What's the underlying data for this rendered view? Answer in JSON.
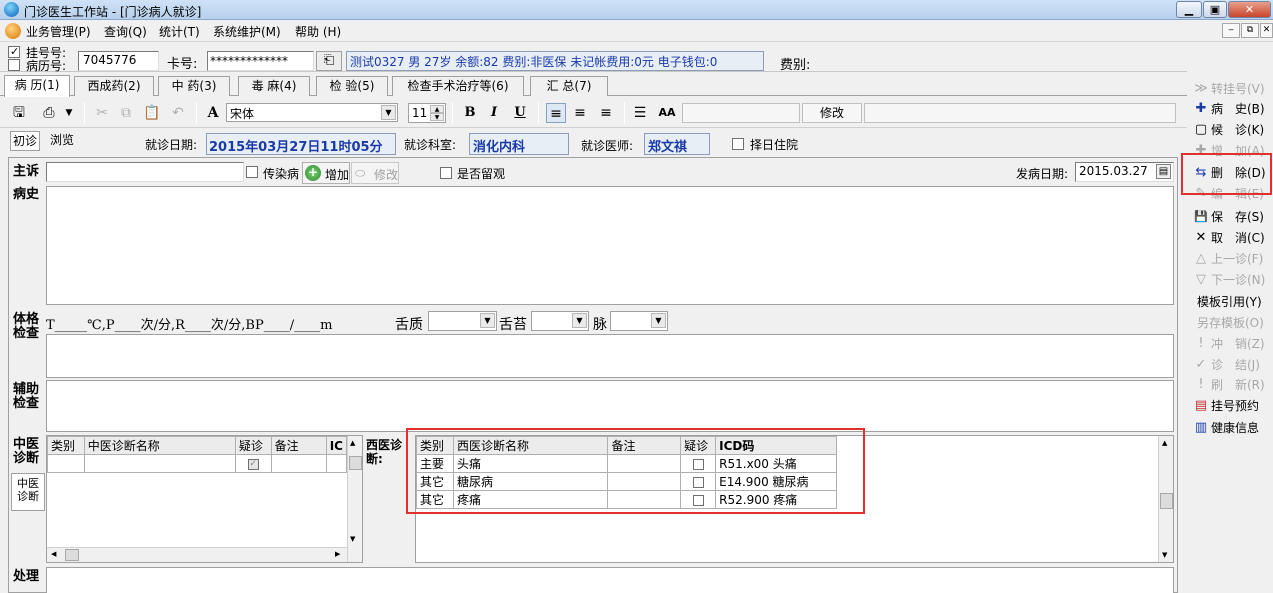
{
  "window": {
    "title": "门诊医生工作站 - [门诊病人就诊]",
    "btn_min": "▁",
    "btn_max": "▣",
    "btn_close": "✕"
  },
  "menu": [
    "业务管理(P)",
    "查询(Q)",
    "统计(T)",
    "系统维护(M)",
    "帮助 (H)"
  ],
  "mdi_buttons": [
    "‒",
    "⧉",
    "✕"
  ],
  "patient": {
    "reg_label": "挂号号:",
    "record_label": "病历号:",
    "record_no": "7045776",
    "card_label": "卡号:",
    "card_value": "*************",
    "info": "测试0327 男 27岁 余额:82 费别:非医保 未记帐费用:0元 电子钱包:0",
    "fee_label": "费别:"
  },
  "tabs": [
    "病 历(1)",
    "西成药(2)",
    "中 药(3)",
    "毒 麻(4)",
    "检 验(5)",
    "检查手术治疗等(6)",
    "汇 总(7)"
  ],
  "toolbar": {
    "font_name": "宋体",
    "font_size": "11",
    "bold": "B",
    "italic": "I",
    "underline": "U",
    "modify": "修改"
  },
  "visit": {
    "first_visit": "初诊",
    "browse": "浏览",
    "date_label": "就诊日期:",
    "date_value": "2015年03月27日11时05分",
    "dept_label": "就诊科室:",
    "dept_value": "消化内科",
    "doctor_label": "就诊医师:",
    "doctor_value": "郑文祺",
    "admit_label": "择日住院"
  },
  "complaint": {
    "label": "主诉",
    "infectious_label": "传染病",
    "add_label": "增加",
    "edit_label": "修改",
    "observe_label": "是否留观",
    "onset_label": "发病日期:",
    "onset_value": "2015.03.27"
  },
  "sections": {
    "history": "病史",
    "exam": "体格检查",
    "vitals": "T_____℃,P____次/分,R____次/分,BP____/____m",
    "tongue": "舌质",
    "coating": "舌苔",
    "pulse": "脉",
    "aux": "辅助检查",
    "tcm_diag": "中医诊断",
    "tcm_side": "中医诊断",
    "west_diag": "西医诊断:",
    "treatment": "处理"
  },
  "tcm_table": {
    "headers": [
      "类别",
      "中医诊断名称",
      "疑诊",
      "备注",
      "IC"
    ]
  },
  "west_table": {
    "headers": [
      "类别",
      "西医诊断名称",
      "备注",
      "疑诊",
      "ICD码"
    ],
    "rows": [
      {
        "type": "主要",
        "name": "头痛",
        "note": "",
        "icd": "R51.x00 头痛"
      },
      {
        "type": "其它",
        "name": "糖尿病",
        "note": "",
        "icd": "E14.900 糖尿病"
      },
      {
        "type": "其它",
        "name": "疼痛",
        "note": "",
        "icd": "R52.900 疼痛"
      }
    ]
  },
  "sidebar": [
    {
      "icon": "≫",
      "label": "转挂号(V)",
      "enabled": false
    },
    {
      "icon": "✚",
      "label": "病　史(B)",
      "enabled": true
    },
    {
      "icon": "▢",
      "label": "候　诊(K)",
      "enabled": true
    },
    {
      "icon": "✚",
      "label": "增　加(A)",
      "enabled": false
    },
    {
      "icon": "⇆",
      "label": "删　除(D)",
      "enabled": true
    },
    {
      "icon": "✎",
      "label": "编　辑(E)",
      "enabled": false
    },
    {
      "icon": "💾",
      "label": "保　存(S)",
      "enabled": true
    },
    {
      "icon": "✕",
      "label": "取　消(C)",
      "enabled": true
    },
    {
      "icon": "△",
      "label": "上一诊(F)",
      "enabled": false
    },
    {
      "icon": "▽",
      "label": "下一诊(N)",
      "enabled": false
    },
    {
      "icon": "",
      "label": "模板引用(Y)",
      "enabled": true
    },
    {
      "icon": "",
      "label": "另存模板(O)",
      "enabled": false
    },
    {
      "icon": "!",
      "label": "冲　销(Z)",
      "enabled": false
    },
    {
      "icon": "✓",
      "label": "诊　结(J)",
      "enabled": false
    },
    {
      "icon": "!",
      "label": "刷　新(R)",
      "enabled": false
    },
    {
      "icon": "▤",
      "label": "挂号预约",
      "enabled": true
    },
    {
      "icon": "▥",
      "label": "健康信息",
      "enabled": true
    }
  ],
  "colors": {
    "accent_blue": "#1a3aa8",
    "highlight_red": "#e03030",
    "title_grad": "#b7d0ec"
  }
}
